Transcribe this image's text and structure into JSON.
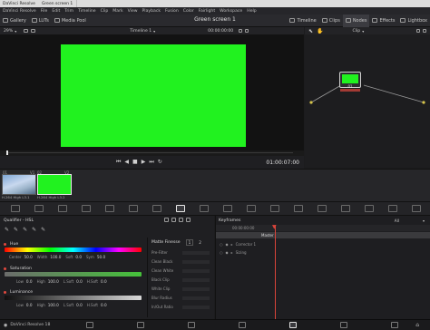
{
  "titlebar": {
    "app_name": "DaVinci Resolve",
    "tab": "Green screen 1"
  },
  "menu": [
    "DaVinci Resolve",
    "File",
    "Edit",
    "Trim",
    "Timeline",
    "Clip",
    "Mark",
    "View",
    "Playback",
    "Fusion",
    "Color",
    "Fairlight",
    "Workspace",
    "Help"
  ],
  "toolbar": {
    "left": [
      "Gallery",
      "LUTs",
      "Media Pool"
    ],
    "project_title": "Green screen 1",
    "right": [
      "Timeline",
      "Clips",
      "Nodes",
      "Effects",
      "Lightbox"
    ]
  },
  "viewer": {
    "zoom": "29%",
    "timeline_name": "Timeline 1",
    "timecode_top": "00:00:00:00",
    "timecode": "01:00:07:00",
    "clip_mode": "Clip",
    "frame_color": "#21f21f"
  },
  "node": {
    "label": "01"
  },
  "clips": [
    {
      "index": "01",
      "track": "V1",
      "codec": "H.264 High L3.1"
    },
    {
      "index": "02",
      "track": "V2",
      "codec": "H.264 High L3.2"
    }
  ],
  "qualifier": {
    "title": "Qualifier - HSL",
    "hue": {
      "label": "Hue",
      "center": "Center",
      "center_val": "50.0",
      "width": "Width",
      "width_val": "100.0",
      "soft": "Soft",
      "soft_val": "0.0",
      "sym": "Sym",
      "sym_val": "50.0"
    },
    "saturation": {
      "label": "Saturation",
      "low": "Low",
      "low_val": "0.0",
      "high": "High",
      "high_val": "100.0",
      "lsoft": "L.Soft",
      "lsoft_val": "0.0",
      "hsoft": "H.Soft",
      "hsoft_val": "0.0"
    },
    "luminance": {
      "label": "Luminance",
      "low": "Low",
      "low_val": "0.0",
      "high": "High",
      "high_val": "100.0",
      "lsoft": "L.Soft",
      "lsoft_val": "0.0",
      "hsoft": "H.Soft",
      "hsoft_val": "0.0"
    },
    "matte": {
      "title": "Matte Finesse",
      "page1": "1",
      "page2": "2",
      "params": [
        "Pre-Filter",
        "Clean Black",
        "Clean White",
        "Black Clip",
        "White Clip",
        "Blur Radius",
        "In/Out Ratio"
      ]
    }
  },
  "keyframes": {
    "title": "Keyframes",
    "filter": "All",
    "timecode": "00:00:00:00",
    "master": "Master",
    "rows": [
      "Corrector 1",
      "Sizing"
    ]
  },
  "status": {
    "app_label": "DaVinci Resolve 18"
  }
}
